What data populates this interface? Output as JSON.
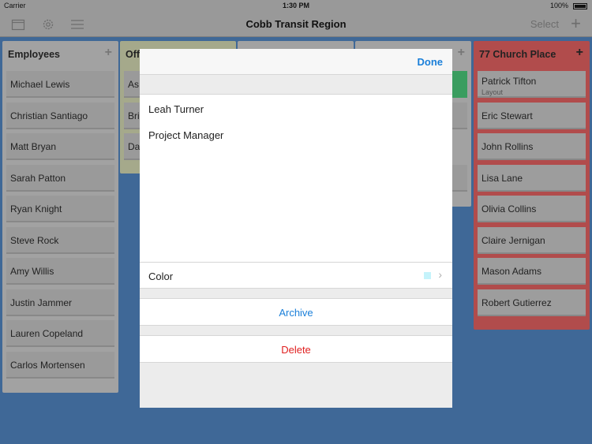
{
  "status_bar": {
    "carrier": "Carrier",
    "time": "1:30 PM",
    "battery": "100%"
  },
  "nav": {
    "title": "Cobb Transit Region",
    "select_label": "Select",
    "add_label": "+"
  },
  "columns": {
    "employees": {
      "title": "Employees",
      "cards": [
        "Michael Lewis",
        "Christian Santiago",
        "Matt Bryan",
        "Sarah Patton",
        "Ryan Knight",
        "Steve Rock",
        "Amy Willis",
        "Justin Jammer",
        "Lauren Copeland",
        "Carlos Mortensen"
      ]
    },
    "office": {
      "title": "Off",
      "cards": [
        "As",
        "Bri",
        "Da"
      ]
    },
    "church": {
      "title": "77 Church Place",
      "cards": [
        {
          "name": "Patrick Tifton",
          "sub": "Layout"
        },
        {
          "name": "Eric Stewart"
        },
        {
          "name": "John Rollins"
        },
        {
          "name": "Lisa Lane"
        },
        {
          "name": "Olivia Collins"
        },
        {
          "name": "Claire Jernigan"
        },
        {
          "name": "Mason Adams"
        },
        {
          "name": "Robert Gutierrez"
        }
      ]
    }
  },
  "modal": {
    "done_label": "Done",
    "name_value": "Leah Turner",
    "title_value": "Project Manager",
    "color_label": "Color",
    "color_value": "#c5f3fb",
    "archive_label": "Archive",
    "delete_label": "Delete"
  },
  "colors": {
    "accent": "#1a7fd9",
    "danger": "#e02020",
    "church_column": "#b14c4c",
    "office_column": "#a5a98b"
  }
}
